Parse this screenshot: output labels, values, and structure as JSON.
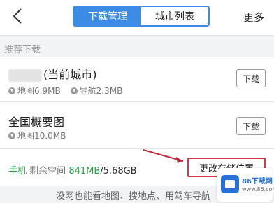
{
  "header": {
    "tabs": [
      {
        "label": "下载管理",
        "active": true
      },
      {
        "label": "城市列表",
        "active": false
      }
    ],
    "more_label": "更多"
  },
  "section_title": "推荐下载",
  "items": [
    {
      "title": "(当前城市)",
      "map_size": "地图6.9MB",
      "nav_size": "导航2.3MB",
      "button_label": "下载"
    },
    {
      "title": "全国概要图",
      "map_size": "地图10.0MB",
      "button_label": "下载"
    }
  ],
  "storage": {
    "phone_label": "手机",
    "free_label": "剩余空间",
    "free_value": "841MB",
    "total_value": "/5.68GB",
    "change_button_label": "更改存储位置"
  },
  "bottom_tip": "没网也能看地图、搜地点、用驾车导航",
  "watermark": {
    "name": "86下载网",
    "sub": "www.86.com"
  },
  "colors": {
    "accent": "#3c8ce6",
    "storage_green": "#2f9e4a",
    "highlight_red": "#d8344a"
  }
}
